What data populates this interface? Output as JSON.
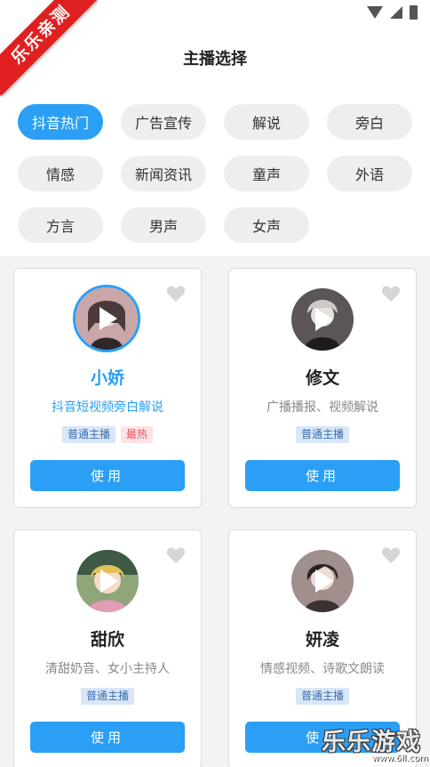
{
  "watermark_ribbon": "乐乐亲测",
  "header": {
    "back_glyph": "‹",
    "title": "主播选择"
  },
  "categories": [
    {
      "label": "抖音热门",
      "active": true
    },
    {
      "label": "广告宣传"
    },
    {
      "label": "解说"
    },
    {
      "label": "旁白"
    },
    {
      "label": "情感"
    },
    {
      "label": "新闻资讯"
    },
    {
      "label": "童声"
    },
    {
      "label": "外语"
    },
    {
      "label": "方言"
    },
    {
      "label": "男声"
    },
    {
      "label": "女声"
    }
  ],
  "anchors": [
    {
      "name": "小娇",
      "desc": "抖音短视频旁白解说",
      "tags": [
        "普通主播",
        "最热"
      ],
      "use_label": "使用",
      "selected": true,
      "avatar_color": "#c9a7a8"
    },
    {
      "name": "修文",
      "desc": "广播播报、视频解说",
      "tags": [
        "普通主播"
      ],
      "use_label": "使用",
      "avatar_color": "#5b5557"
    },
    {
      "name": "甜欣",
      "desc": "清甜奶音、女小主持人",
      "tags": [
        "普通主播"
      ],
      "use_label": "使用",
      "avatar_color": "#b7c59a"
    },
    {
      "name": "妍凌",
      "desc": "情感视频、诗歌文朗读",
      "tags": [
        "普通主播"
      ],
      "use_label": "使用",
      "avatar_color": "#8a6f6c"
    }
  ],
  "corner_watermark": {
    "main": "乐乐游戏",
    "url": "www.6ll.com"
  },
  "colors": {
    "accent": "#2a9ff5",
    "hot_tag": "#e5525f"
  }
}
